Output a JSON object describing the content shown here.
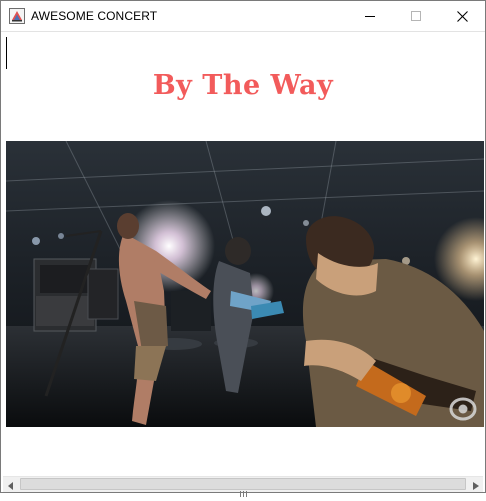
{
  "window": {
    "title": "AWESOME CONCERT",
    "app_icon": "java-app-icon",
    "controls": [
      "minimize-icon",
      "maximize-icon",
      "close-icon"
    ]
  },
  "content": {
    "song_title": "By The Way",
    "song_title_color": "#f25b5b"
  },
  "video": {
    "media": "concert-stage-frame",
    "watermark": "cbs-eye-logo"
  },
  "scrollbar": {
    "left_arrow": "arrow-left-icon",
    "right_arrow": "arrow-right-icon"
  }
}
